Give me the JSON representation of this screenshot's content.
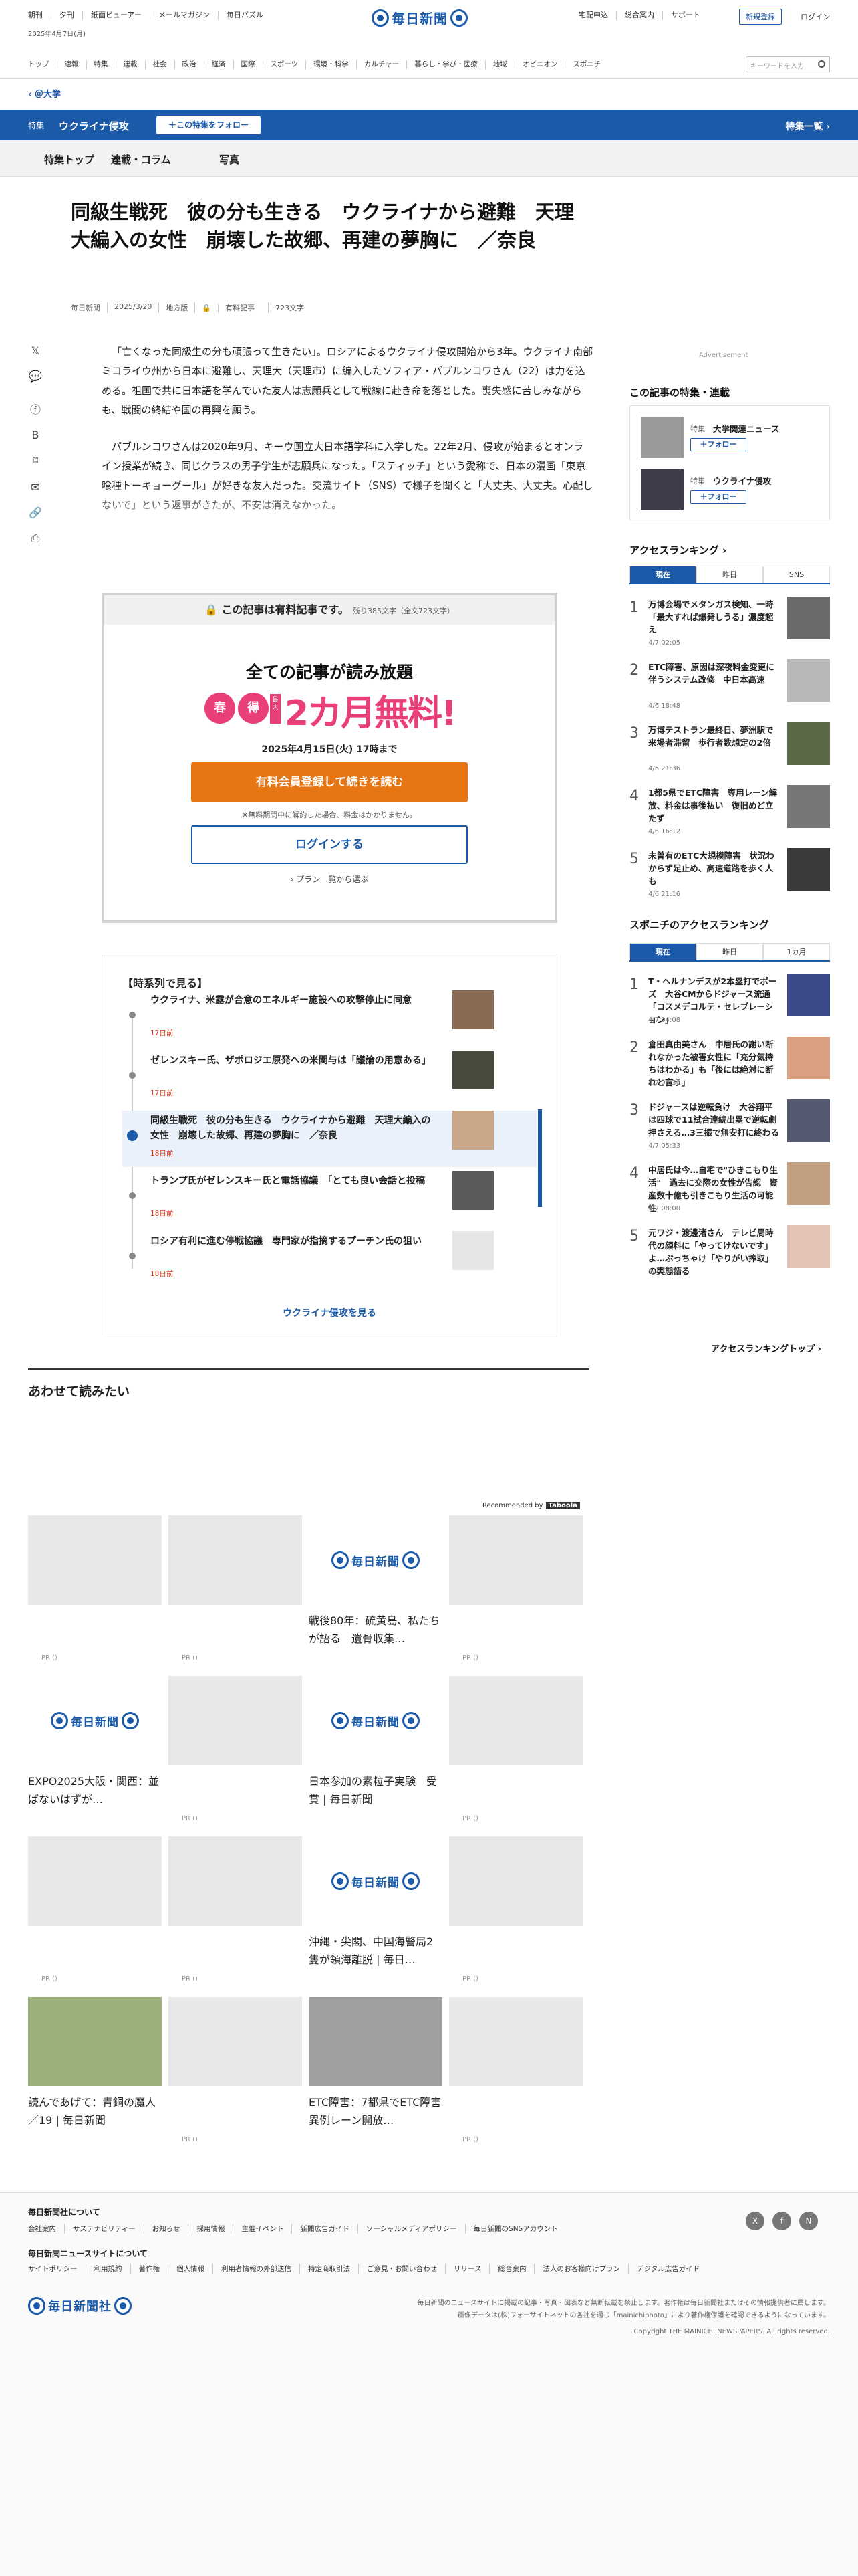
{
  "header": {
    "top_links": [
      "朝刊",
      "夕刊",
      "紙面ビューアー",
      "メールマガジン",
      "毎日パズル"
    ],
    "date": "2025年4月7日(月)",
    "logo_text": "毎日新聞",
    "right_links": [
      "宅配申込",
      "総合案内",
      "サポート"
    ],
    "register": "新規登録",
    "login": "ログイン",
    "categories": [
      "トップ",
      "速報",
      "特集",
      "連載",
      "社会",
      "政治",
      "経済",
      "国際",
      "スポーツ",
      "環境・科学",
      "カルチャー",
      "暮らし・学び・医療",
      "地域",
      "オピニオン",
      "スポニチ"
    ],
    "search_placeholder": "キーワードを入力"
  },
  "breadcrumb": "＠大学",
  "feature": {
    "label": "特集",
    "name": "ウクライナ侵攻",
    "follow": "＋この特集をフォロー",
    "list": "特集一覧 ›",
    "tabs": [
      "特集トップ",
      "連載・コラム",
      "写真"
    ]
  },
  "article": {
    "title": "同級生戦死　彼の分も生きる　ウクライナから避難　天理大編入の女性　崩壊した故郷、再建の夢胸に　／奈良",
    "source": "毎日新聞",
    "date": "2025/3/20",
    "section": "地方版",
    "paid": "有料記事",
    "chars": "723文字",
    "p1": "「亡くなった同級生の分も頑張って生きたい」。ロシアによるウクライナ侵攻開始から3年。ウクライナ南部ミコライウ州から日本に避難し、天理大（天理市）に編入したソフィア・パブルンコワさん（22）は力を込める。祖国で共に日本語を学んでいた友人は志願兵として戦線に赴き命を落とした。喪失感に苦しみながらも、戦闘の終結や国の再興を願う。",
    "p2": "パブルンコワさんは2020年9月、キーウ国立大日本語学科に入学した。22年2月、侵攻が始まるとオンライン授業が続き、同じクラスの男子学生が志願兵になった。「スティッチ」という愛称で、日本の漫画「東京喰種トーキョーグール」が好きな友人だった。交流サイト（SNS）で様子を聞くと「大丈夫、大丈夫。心配しないで」という返事がきたが、不安は消えなかった。"
  },
  "paywall": {
    "header": "この記事は有料記事です。",
    "remain": "残り385文字（全文723文字）",
    "headline": "全ての記事が読み放題",
    "badge1": "春",
    "badge2": "得",
    "tag": "最大",
    "offer": "2カ月無料!",
    "until": "2025年4月15日(火) 17時まで",
    "cta": "有料会員登録して続きを読む",
    "note": "※無料期間中に解約した場合、料金はかかりません。",
    "login": "ログインする",
    "plans": "› プラン一覧から選ぶ"
  },
  "timeline": {
    "title": "【時系列で見る】",
    "items": [
      {
        "title": "ウクライナ、米露が合意のエネルギー施設への攻撃停止に同意",
        "date": "17日前"
      },
      {
        "title": "ゼレンスキー氏、ザポロジエ原発への米関与は「議論の用意ある」",
        "date": "17日前"
      },
      {
        "title": "同級生戦死　彼の分も生きる　ウクライナから避難　天理大編入の女性　崩壊した故郷、再建の夢胸に　／奈良",
        "date": "18日前"
      },
      {
        "title": "トランプ氏がゼレンスキー氏と電話協議　「とても良い会話と投稿",
        "date": "18日前"
      },
      {
        "title": "ロシア有利に進む停戦協議　専門家が指摘するプーチン氏の狙い",
        "date": "18日前"
      }
    ],
    "more": "ウクライナ侵攻を見る"
  },
  "related": {
    "heading": "あわせて読みたい",
    "recommended": "Recommended by",
    "taboola": "Taboola",
    "pr": "PR ()",
    "cards": [
      {
        "caption": ""
      },
      {
        "caption": ""
      },
      {
        "caption": "戦後80年：硫黄島、私たちが語る　遺骨収集…"
      },
      {
        "caption": ""
      },
      {
        "caption": "EXPO2025大阪・関西：並ばないはずが…"
      },
      {
        "caption": ""
      },
      {
        "caption": "日本参加の素粒子実験　受賞 | 毎日新聞"
      },
      {
        "caption": ""
      },
      {
        "caption": ""
      },
      {
        "caption": ""
      },
      {
        "caption": "沖縄・尖閣、中国海警局2隻が領海離脱 | 毎日…"
      },
      {
        "caption": ""
      },
      {
        "caption": "読んであげて：青銅の魔人／19 | 毎日新聞"
      },
      {
        "caption": ""
      },
      {
        "caption": "ETC障害：7都県でETC障害　異例レーン開放…"
      },
      {
        "caption": ""
      }
    ]
  },
  "sidebar": {
    "ad": "Advertisement",
    "feature_heading": "この記事の特集・連載",
    "features": [
      {
        "kind": "特集",
        "name": "大学関連ニュース",
        "follow": "＋フォロー"
      },
      {
        "kind": "特集",
        "name": "ウクライナ侵攻",
        "follow": "＋フォロー"
      }
    ],
    "ranking_heading": "アクセスランキング ›",
    "ranking_tabs": [
      "現在",
      "昨日",
      "SNS"
    ],
    "ranking": [
      {
        "no": "1",
        "title": "万博会場でメタンガス検知、一時「最大すれば爆発しうる」濃度超え",
        "date": "4/7 02:05"
      },
      {
        "no": "2",
        "title": "ETC障害、原因は深夜料金変更に伴うシステム改修　中日本高速",
        "date": "4/6 18:48"
      },
      {
        "no": "3",
        "title": "万博テストラン最終日、夢洲駅で来場者滞留　歩行者数想定の2倍",
        "date": "4/6 21:36"
      },
      {
        "no": "4",
        "title": "1都5県でETC障害　専用レーン解放、料金は事後払い　復旧めど立たず",
        "date": "4/6 16:12"
      },
      {
        "no": "5",
        "title": "未曽有のETC大規模障害　状況わからず足止め、高速道路を歩く人も",
        "date": "4/6 21:16"
      }
    ],
    "sponichi_heading": "スポニチのアクセスランキング",
    "sponichi_tabs": [
      "現在",
      "昨日",
      "1カ月"
    ],
    "sponichi": [
      {
        "no": "1",
        "title": "T・ヘルナンデスが2本塁打でポーズ　大谷CMからドジャース流通「コスメデコルテ・セレブレーション」",
        "date": "4/7 04:08"
      },
      {
        "no": "2",
        "title": "倉田真由美さん　中居氏の謝い断れなかった被害女性に「充分気持ちはわかる」も「後には絶対に断れと言う」",
        "date": "4/7 06:30"
      },
      {
        "no": "3",
        "title": "ドジャースは逆転負け　大谷翔平は四球で11試合連続出塁で逆転劇押さえる…3三振で無安打に終わる",
        "date": "4/7 05:33"
      },
      {
        "no": "4",
        "title": "中居氏は今…自宅で\"ひきこもり生活\"　過去に交際の女性が告認　資産数十億も引きこもり生活の可能性",
        "date": "4/7 08:00"
      },
      {
        "no": "5",
        "title": "元ワジ・渡邊渚さん　テレビ局時代の顔料に「やってけないです」よ…ぶっちゃけ「やりがい搾取」の実態語る",
        "date": "4/7 13:02"
      }
    ],
    "ranking_more": "アクセスランキングトップ ›"
  },
  "footer": {
    "about": "毎日新聞社について",
    "links1": [
      "会社案内",
      "サステナビリティー",
      "お知らせ",
      "採用情報",
      "主催イベント",
      "新聞広告ガイド",
      "ソーシャルメディアポリシー",
      "毎日新聞のSNSアカウント"
    ],
    "site": "毎日新聞ニュースサイトについて",
    "links2": [
      "サイトポリシー",
      "利用規約",
      "著作権",
      "個人情報",
      "利用者情報の外部送信",
      "特定商取引法",
      "ご意見・お問い合わせ",
      "リリース",
      "総合案内",
      "法人のお客様向けプラン",
      "デジタル広告ガイド"
    ],
    "logo_text": "毎日新聞社",
    "note1": "毎日新聞のニュースサイトに掲載の記事・写真・図表など無断転載を禁止します。著作権は毎日新聞社またはその情報提供者に属します。",
    "note2": "画像データは(株)フォーサイトネットの各社を通じ「mainichiphoto」により著作権保護を確認できるようになっています。",
    "copyright": "Copyright THE MAINICHI NEWSPAPERS. All rights reserved.",
    "sns": [
      "X",
      "f",
      "N"
    ]
  }
}
